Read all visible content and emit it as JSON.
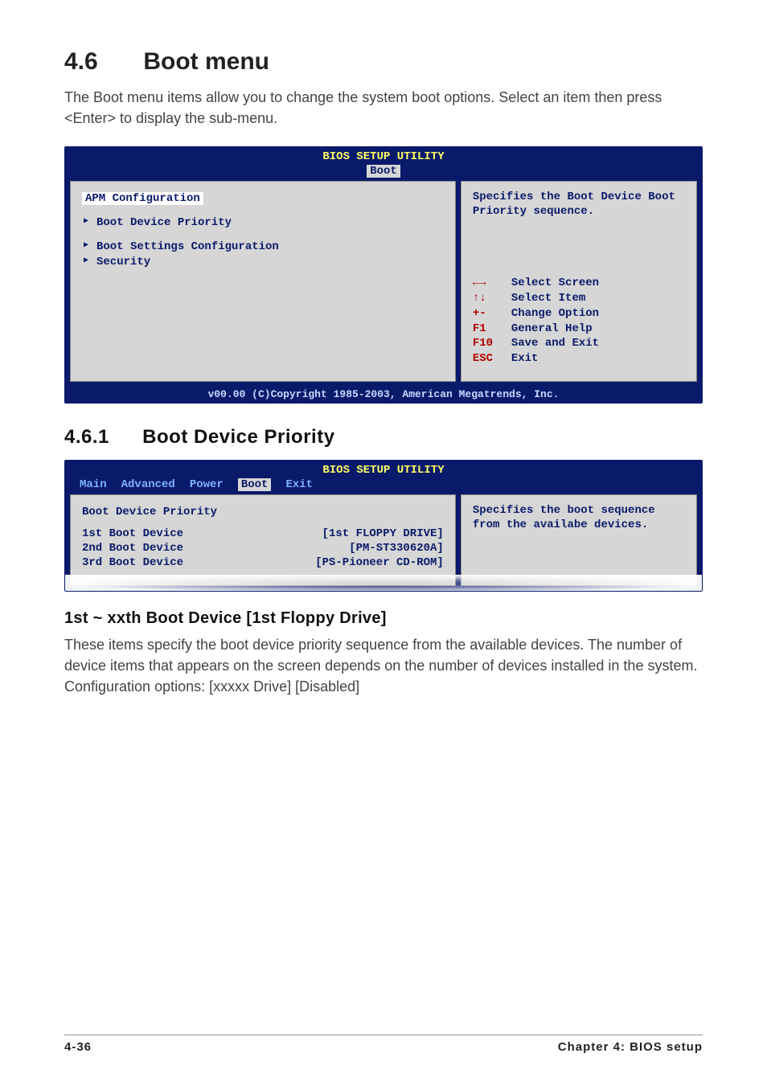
{
  "section": {
    "number": "4.6",
    "title": "Boot menu",
    "intro": "The Boot menu items allow you to change the system boot options. Select an item then press <Enter> to display the sub-menu."
  },
  "bios1": {
    "title": "BIOS SETUP UTILITY",
    "active_tab": "Boot",
    "left": {
      "heading": "APM Configuration",
      "items": [
        "Boot Device Priority",
        "Boot Settings Configuration",
        "Security"
      ]
    },
    "right": {
      "help": "Specifies the Boot Device Boot Priority sequence.",
      "keys": [
        {
          "key": "←→",
          "label": "Select Screen"
        },
        {
          "key": "↑↓",
          "label": "Select Item"
        },
        {
          "key": "+-",
          "label": "Change Option"
        },
        {
          "key": "F1",
          "label": "General Help"
        },
        {
          "key": "F10",
          "label": "Save and Exit"
        },
        {
          "key": "ESC",
          "label": "Exit"
        }
      ]
    },
    "footer": "v00.00 (C)Copyright 1985-2003, American Megatrends, Inc."
  },
  "subsection": {
    "number": "4.6.1",
    "title": "Boot Device Priority"
  },
  "bios2": {
    "title": "BIOS SETUP UTILITY",
    "tabs": [
      "Main",
      "Advanced",
      "Power",
      "Boot",
      "Exit"
    ],
    "active_tab": "Boot",
    "left": {
      "heading": "Boot Device Priority",
      "rows": [
        {
          "label": "1st Boot Device",
          "value": "[1st FLOPPY DRIVE]"
        },
        {
          "label": "2nd Boot Device",
          "value": "[PM-ST330620A]"
        },
        {
          "label": "3rd Boot Device",
          "value": "[PS-Pioneer CD-ROM]"
        }
      ]
    },
    "right": {
      "help": "Specifies the boot sequence from the availabe devices."
    }
  },
  "item": {
    "title": "1st ~ xxth Boot Device [1st Floppy Drive]",
    "body1": "These items specify the boot device priority sequence from the available devices. The number of device items that appears on the screen depends on the number of devices installed in the system.",
    "body2": "Configuration options: [xxxxx Drive] [Disabled]"
  },
  "footer": {
    "left": "4-36",
    "right": "Chapter 4: BIOS setup"
  }
}
